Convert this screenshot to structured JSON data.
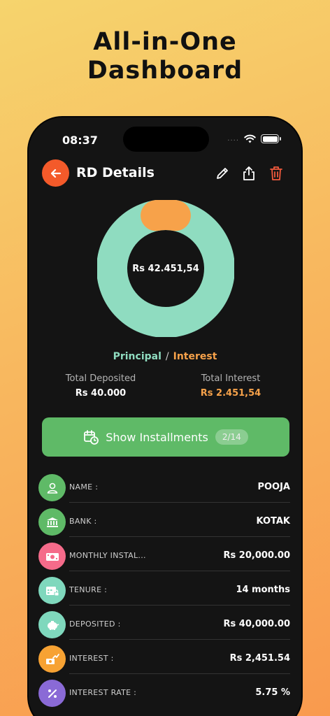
{
  "promo": {
    "line1": "All-in-One",
    "line2": "Dashboard"
  },
  "status_bar": {
    "time": "08:37",
    "signal": "....",
    "wifi_icon": "wifi-icon",
    "battery_icon": "battery-icon"
  },
  "header": {
    "title": "RD Details",
    "back_icon": "arrow-left-icon",
    "edit_icon": "pencil-icon",
    "share_icon": "share-icon",
    "delete_icon": "trash-icon"
  },
  "donut": {
    "center_label": "Rs 42.451,54",
    "principal": 40000,
    "interest": 2451.54
  },
  "legend": {
    "principal": "Principal",
    "separator": "/",
    "interest": "Interest"
  },
  "stats": {
    "total_deposited_label": "Total Deposited",
    "total_deposited_value": "Rs 40.000",
    "total_interest_label": "Total Interest",
    "total_interest_value": "Rs 2.451,54"
  },
  "installments_button": {
    "label": "Show Installments",
    "badge": "2/14",
    "icon": "calendar-clock-icon"
  },
  "details": [
    {
      "key": "NAME :",
      "value": "POOJA",
      "icon": "user-icon",
      "color": "#5fba67"
    },
    {
      "key": "BANK :",
      "value": "KOTAK",
      "icon": "bank-icon",
      "color": "#5fba67"
    },
    {
      "key": "MONTHLY INSTAL...",
      "value": "Rs 20,000.00",
      "icon": "money-icon",
      "color": "#f56b8a"
    },
    {
      "key": "TENURE :",
      "value": "14 months",
      "icon": "calendar-lock-icon",
      "color": "#7fd8bd"
    },
    {
      "key": "DEPOSITED :",
      "value": "Rs 40,000.00",
      "icon": "piggy-bank-icon",
      "color": "#7fd8bd"
    },
    {
      "key": "INTEREST :",
      "value": "Rs 2,451.54",
      "icon": "money-growth-icon",
      "color": "#f7a233"
    },
    {
      "key": "INTEREST RATE :",
      "value": "5.75 %",
      "icon": "percent-icon",
      "color": "#8a6ad6"
    }
  ],
  "colors": {
    "principal": "#8fdcc0",
    "interest": "#f7a24a",
    "accent": "#f45a2a",
    "button": "#5fba67"
  }
}
